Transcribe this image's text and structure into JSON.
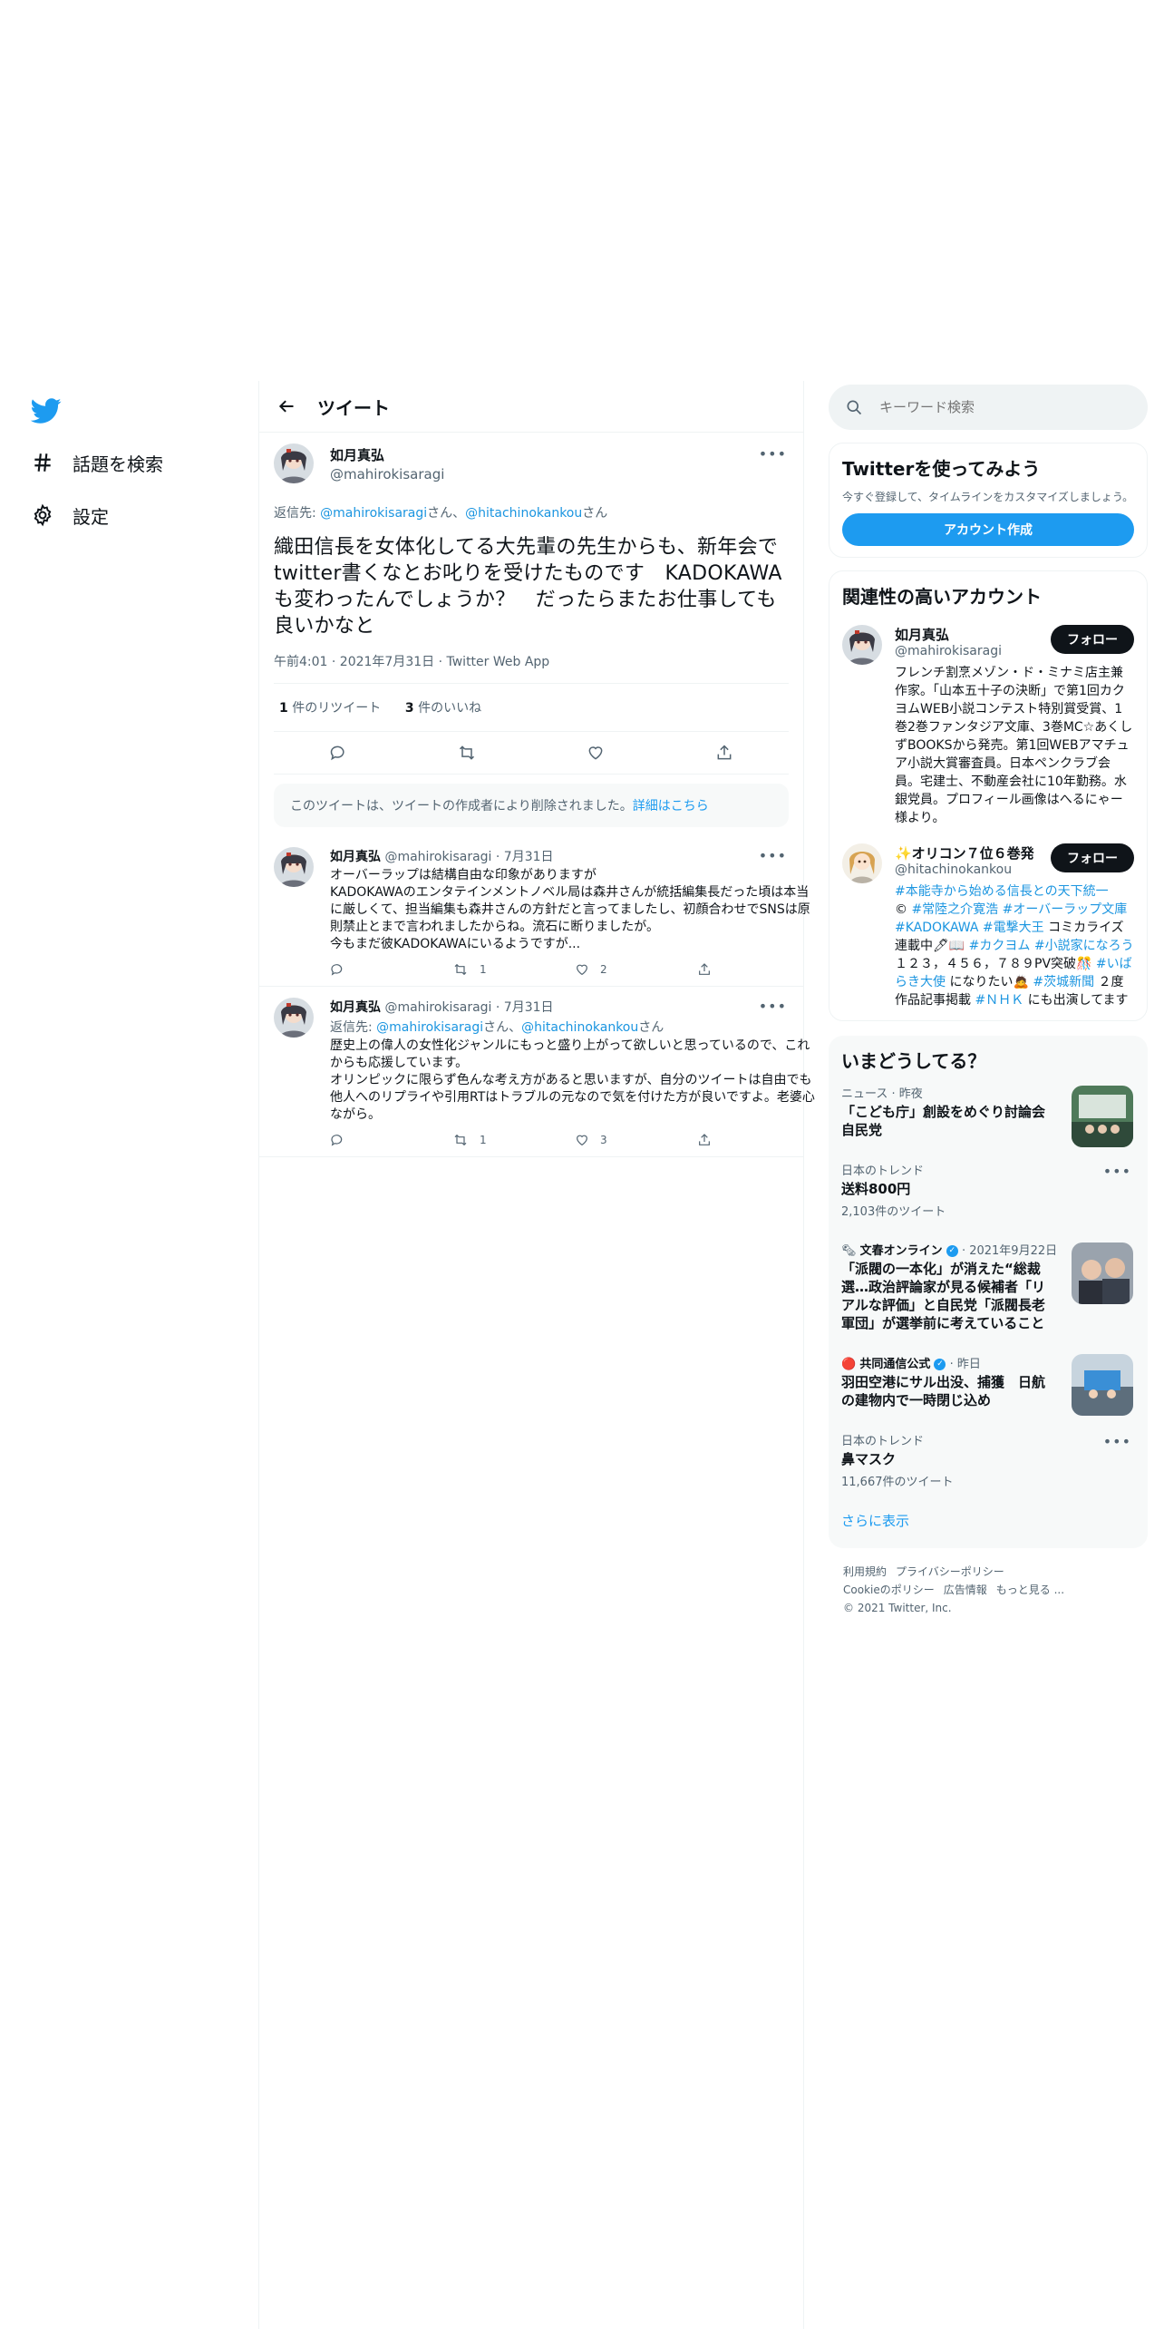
{
  "nav": {
    "items": [
      {
        "label": "話題を検索",
        "icon": "hash-icon"
      },
      {
        "label": "設定",
        "icon": "gear-icon"
      }
    ]
  },
  "header": {
    "title": "ツイート"
  },
  "main_tweet": {
    "name": "如月真弘",
    "handle": "@mahirokisaragi",
    "reply_prefix": "返信先: ",
    "reply_user1": "@mahirokisaragi",
    "reply_sep1": "さん、",
    "reply_user2": "@hitachinokankou",
    "reply_sep2": "さん",
    "text": "織田信長を女体化してる大先輩の先生からも、新年会でtwitter書くなとお叱りを受けたものです　KADOKAWAも変わったんでしょうか？　だったらまたお仕事しても良いかなと",
    "meta": "午前4:01 · 2021年7月31日 · Twitter Web App",
    "retweets_count": "1",
    "retweets_label": " 件のリツイート",
    "likes_count": "3",
    "likes_label": " 件のいいね"
  },
  "deleted_notice": {
    "text": "このツイートは、ツイートの作成者により削除されました。",
    "link": "詳細はこちら"
  },
  "replies": [
    {
      "name": "如月真弘",
      "handle": "@mahirokisaragi",
      "date": " · 7月31日",
      "text": "オーバーラップは結構自由な印象がありますが\nKADOKAWAのエンタテインメントノベル局は森井さんが統括編集長だった頃は本当に厳しくて、担当編集も森井さんの方針だと言ってましたし、初顔合わせでSNSは原則禁止とまで言われましたからね。流石に断りましたが。\n今もまだ彼KADOKAWAにいるようですが...",
      "retweets": "1",
      "likes": "2"
    },
    {
      "name": "如月真弘",
      "handle": "@mahirokisaragi",
      "date": " · 7月31日",
      "reply_prefix": "返信先: ",
      "reply_user1": "@mahirokisaragi",
      "reply_sep1": "さん、",
      "reply_user2": "@hitachinokankou",
      "reply_sep2": "さん",
      "text": "歴史上の偉人の女性化ジャンルにもっと盛り上がって欲しいと思っているので、これからも応援しています。\nオリンピックに限らず色んな考え方があると思いますが、自分のツイートは自由でも他人へのリプライや引用RTはトラブルの元なので気を付けた方が良いですよ。老婆心ながら。",
      "retweets": "1",
      "likes": "3"
    }
  ],
  "search": {
    "placeholder": "キーワード検索"
  },
  "signup": {
    "title": "Twitterを使ってみよう",
    "subtitle": "今すぐ登録して、タイムラインをカスタマイズしましょう。",
    "button": "アカウント作成"
  },
  "related": {
    "title": "関連性の高いアカウント",
    "follow_label": "フォロー",
    "accounts": [
      {
        "name": "如月真弘",
        "handle": "@mahirokisaragi",
        "bio": "フレンチ割烹メゾン・ド・ミナミ店主兼作家。「山本五十子の決断」で第1回カクヨムWEB小説コンテスト特別賞受賞、1巻2巻ファンタジア文庫、3巻MC☆あくしずBOOKSから発売。第1回WEBアマチュア小説大賞審査員。日本ペンクラブ会員。宅建士、不動産会社に10年勤務。水銀党員。プロフィール画像はへるにゃー様より。"
      },
      {
        "name": "✨オリコン７位６巻発",
        "handle": "@hitachinokankou",
        "bio_a": "#本能寺から始める信長との天下統一",
        "bio_b": "© ",
        "bio_c": "#常陸之介寛浩 #オーバーラップ文庫 #KADOKAWA #電撃大王",
        "bio_d": " コミカライズ連載中🖊📖 ",
        "bio_e": "#カクヨム #小説家になろう",
        "bio_f": " １２３，４５６，７８９PV突破🎊 ",
        "bio_g": "#いばらき大使",
        "bio_h": " になりたい🙇 ",
        "bio_i": "#茨城新聞",
        "bio_j": " ２度作品記事掲載 ",
        "bio_k": "#ＮＨＫ",
        "bio_l": " にも出演してます"
      }
    ]
  },
  "trends": {
    "title": "いまどうしてる？",
    "items": [
      {
        "context": "ニュース · 昨夜",
        "title": "「こども庁」創設をめぐり討論会　自民党",
        "count": ""
      },
      {
        "context": "日本のトレンド",
        "title": "送料800円",
        "count": "2,103件のツイート"
      },
      {
        "context_source": "文春オンライン",
        "context_time": " · 2021年9月22日",
        "title": "「派閥の一本化」が消えた“総裁選…政治評論家が見る候補者「リアルな評価」と自民党「派閥長老軍団」が選挙前に考えていること",
        "count": ""
      },
      {
        "context_source": "共同通信公式",
        "context_time": " · 昨日",
        "title": "羽田空港にサル出没、捕獲　日航の建物内で一時閉じ込め",
        "count": ""
      },
      {
        "context": "日本のトレンド",
        "title": "鼻マスク",
        "count": "11,667件のツイート"
      }
    ],
    "show_more": "さらに表示"
  },
  "footer": {
    "links": [
      "利用規約",
      "プライバシーポリシー",
      "Cookieのポリシー",
      "広告情報",
      "もっと見る ..."
    ],
    "copyright": "© 2021 Twitter, Inc."
  },
  "colors": {
    "accent": "#1d9bf0",
    "text": "#0f1419",
    "muted": "#536471",
    "border": "#eff3f4"
  }
}
